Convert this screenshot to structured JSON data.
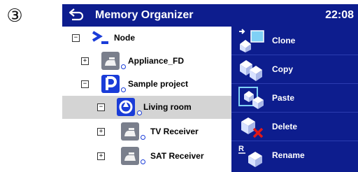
{
  "step_marker": "③",
  "header": {
    "title": "Memory Organizer",
    "time": "22:08"
  },
  "tree": [
    {
      "label": "Node",
      "toggle": "−",
      "icon": "terminal-prompt-icon"
    },
    {
      "label": "Appliance_FD",
      "toggle": "+",
      "icon": "appliance-icon"
    },
    {
      "label": "Sample project",
      "toggle": "−",
      "icon": "project-icon"
    },
    {
      "label": "Living room",
      "toggle": "−",
      "icon": "location-icon",
      "selected": true
    },
    {
      "label": "TV Receiver",
      "toggle": "+",
      "icon": "appliance-icon"
    },
    {
      "label": "SAT Receiver",
      "toggle": "+",
      "icon": "appliance-icon"
    }
  ],
  "actions": [
    {
      "label": "Clone",
      "icon": "clone-icon"
    },
    {
      "label": "Copy",
      "icon": "copy-icon"
    },
    {
      "label": "Paste",
      "icon": "paste-icon"
    },
    {
      "label": "Delete",
      "icon": "delete-icon"
    },
    {
      "label": "Rename",
      "icon": "rename-icon"
    }
  ],
  "colors": {
    "header_bg": "#0d1d8e",
    "action_bg": "#0d1d8e",
    "selected_row": "#d4d4d4",
    "accent": "#1a3cd8"
  }
}
